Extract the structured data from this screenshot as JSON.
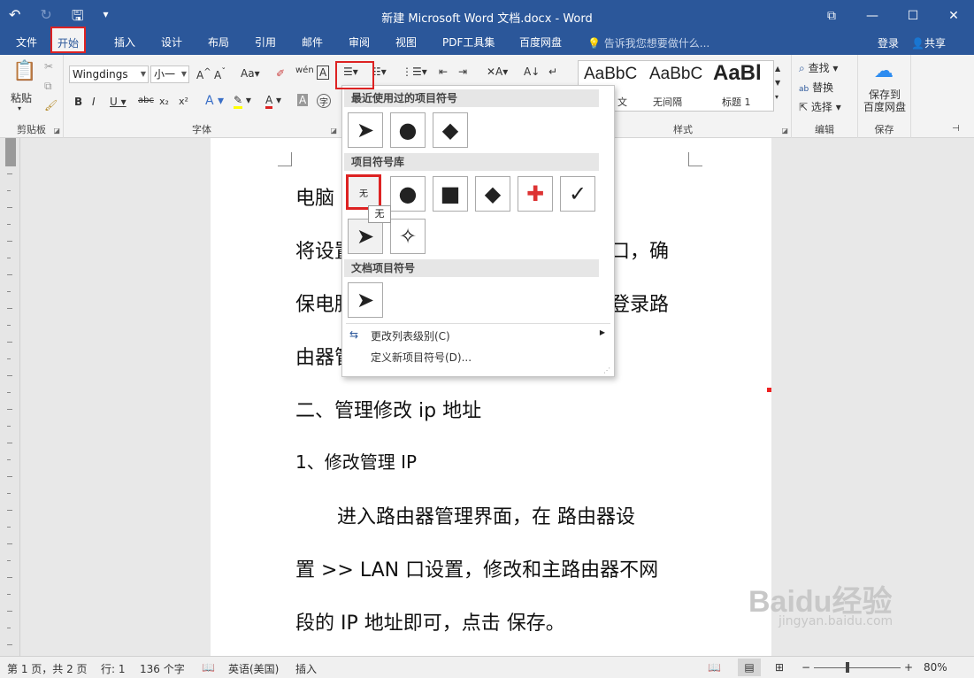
{
  "window": {
    "title": "新建 Microsoft Word 文档.docx - Word",
    "buttons": [
      "⧉",
      "—",
      "☐",
      "✕"
    ]
  },
  "qat": {
    "undo": "↶",
    "redo": "↻",
    "save": "🖫",
    "customize": "▾"
  },
  "tabs": [
    "文件",
    "开始",
    "插入",
    "设计",
    "布局",
    "引用",
    "邮件",
    "审阅",
    "视图",
    "PDF工具集",
    "百度网盘"
  ],
  "tell_me": "告诉我您想要做什么...",
  "account": {
    "login": "登录",
    "share": "共享"
  },
  "ribbon": {
    "clipboard": {
      "paste": "粘贴",
      "label": "剪贴板"
    },
    "font": {
      "name": "Wingdings",
      "size": "小一",
      "label": "字体"
    },
    "styles": {
      "previews": [
        "AaBbC",
        "AaBbC",
        "AaBl"
      ],
      "names": [
        "文",
        "无间隔",
        "标题 1"
      ],
      "label": "样式"
    },
    "editing": {
      "find": "查找",
      "replace": "替换",
      "select": "选择",
      "label": "编辑"
    },
    "save_group": {
      "save_to_baidu": "保存到\n百度网盘",
      "label": "保存"
    }
  },
  "document": {
    "lines": [
      "电脑",
      "将设置",
      "口，确",
      "保电脑",
      "登录路",
      "由器管",
      "二、管理修改 ip 地址",
      "1、修改管理 IP",
      "进入路由器管理界面，在  路由器设",
      "置  >> LAN 口设置，修改和主路由器不网",
      "段的 IP 地址即可，点击  保存。"
    ]
  },
  "bullet_menu": {
    "recent_header": "最近使用过的项目符号",
    "recent": [
      "➤",
      "●",
      "◆"
    ],
    "library_header": "项目符号库",
    "library": [
      "无",
      "●",
      "■",
      "◆",
      "✚",
      "✓",
      "➤",
      "✧"
    ],
    "document_header": "文档项目符号",
    "document": [
      "➤"
    ],
    "tooltip": "无",
    "change_level": "更改列表级别(C)",
    "define_new": "定义新项目符号(D)..."
  },
  "status": {
    "page": "第 1 页，共 2 页",
    "line": "行: 1",
    "chars": "136 个字",
    "lang": "英语(美国)",
    "mode": "插入",
    "zoom": "80%"
  },
  "watermark": {
    "brand": "Baidu经验",
    "url": "jingyan.baidu.com"
  }
}
